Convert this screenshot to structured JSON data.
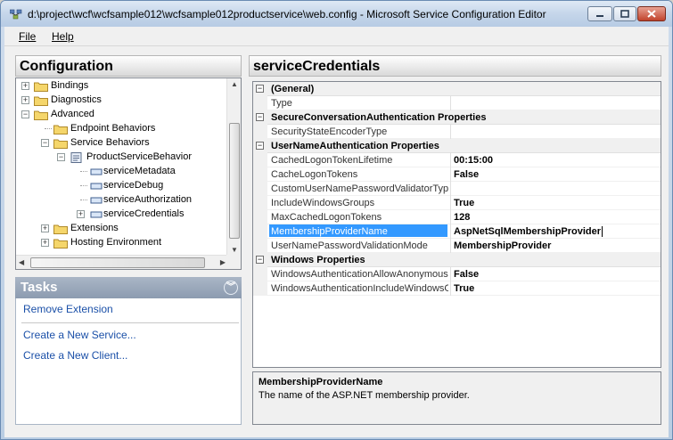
{
  "window": {
    "title": "d:\\project\\wcf\\wcfsample012\\wcfsample012productservice\\web.config - Microsoft Service Configuration Editor"
  },
  "menu": {
    "file": "File",
    "help": "Help"
  },
  "configuration": {
    "header": "Configuration",
    "tree": [
      {
        "label": "Bindings",
        "expander": "+"
      },
      {
        "label": "Diagnostics",
        "expander": "+"
      },
      {
        "label": "Advanced",
        "expander": "−"
      },
      {
        "label": "Endpoint Behaviors",
        "expander": ""
      },
      {
        "label": "Service Behaviors",
        "expander": "−"
      },
      {
        "label": "ProductServiceBehavior",
        "expander": "−"
      },
      {
        "label": "serviceMetadata",
        "expander": ""
      },
      {
        "label": "serviceDebug",
        "expander": ""
      },
      {
        "label": "serviceAuthorization",
        "expander": ""
      },
      {
        "label": "serviceCredentials",
        "expander": "+"
      },
      {
        "label": "Extensions",
        "expander": "+"
      },
      {
        "label": "Hosting Environment",
        "expander": "+"
      }
    ]
  },
  "tasks": {
    "header": "Tasks",
    "links": [
      "Remove Extension",
      "Create a New Service...",
      "Create a New Client..."
    ]
  },
  "properties": {
    "header": "serviceCredentials",
    "rows": [
      {
        "type": "category",
        "name": "(General)"
      },
      {
        "type": "prop",
        "name": "Type",
        "value": ""
      },
      {
        "type": "category",
        "name": "SecureConversationAuthentication Properties"
      },
      {
        "type": "prop",
        "name": "SecurityStateEncoderType",
        "value": ""
      },
      {
        "type": "category",
        "name": "UserNameAuthentication Properties"
      },
      {
        "type": "prop",
        "name": "CachedLogonTokenLifetime",
        "value": "00:15:00"
      },
      {
        "type": "prop",
        "name": "CacheLogonTokens",
        "value": "False"
      },
      {
        "type": "prop",
        "name": "CustomUserNamePasswordValidatorType",
        "value": ""
      },
      {
        "type": "prop",
        "name": "IncludeWindowsGroups",
        "value": "True"
      },
      {
        "type": "prop",
        "name": "MaxCachedLogonTokens",
        "value": "128"
      },
      {
        "type": "prop",
        "name": "MembershipProviderName",
        "value": "AspNetSqlMembershipProvider",
        "selected": true
      },
      {
        "type": "prop",
        "name": "UserNamePasswordValidationMode",
        "value": "MembershipProvider"
      },
      {
        "type": "category",
        "name": "Windows Properties"
      },
      {
        "type": "prop",
        "name": "WindowsAuthenticationAllowAnonymousLogons",
        "value": "False"
      },
      {
        "type": "prop",
        "name": "WindowsAuthenticationIncludeWindowsGroups",
        "value": "True"
      }
    ]
  },
  "description": {
    "title": "MembershipProviderName",
    "text": "The name of the ASP.NET membership provider."
  },
  "colors": {
    "selection": "#3399ff",
    "link": "#1b50a8",
    "tasks_header": "#8c9bb0"
  }
}
